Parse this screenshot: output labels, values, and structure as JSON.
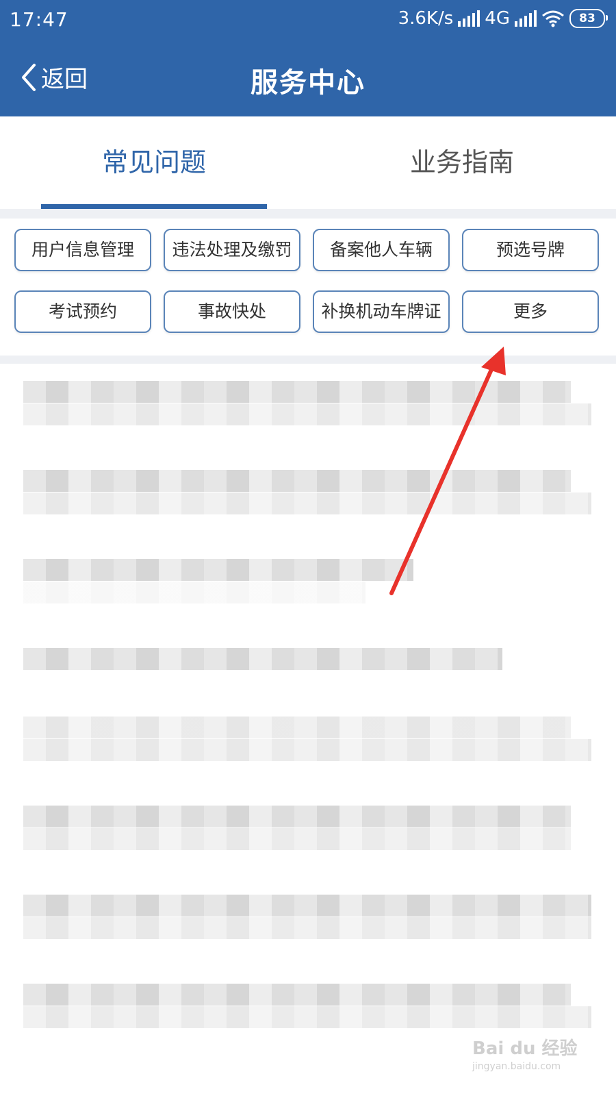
{
  "status_bar": {
    "time": "17:47",
    "net_speed": "3.6K/s",
    "network": "4G",
    "battery": "83"
  },
  "nav": {
    "back_label": "返回",
    "title": "服务中心"
  },
  "tabs": [
    {
      "label": "常见问题",
      "active": true
    },
    {
      "label": "业务指南",
      "active": false
    }
  ],
  "chips": [
    "用户信息管理",
    "违法处理及缴罚",
    "备案他人车辆",
    "预选号牌",
    "考试预约",
    "事故快处",
    "补换机动车牌证",
    "更多"
  ],
  "watermark": {
    "brand": "Bai du 经验",
    "url": "jingyan.baidu.com"
  },
  "colors": {
    "primary": "#2f65a9",
    "chip_border": "#5a84b8",
    "annotation_arrow": "#e8322b"
  }
}
